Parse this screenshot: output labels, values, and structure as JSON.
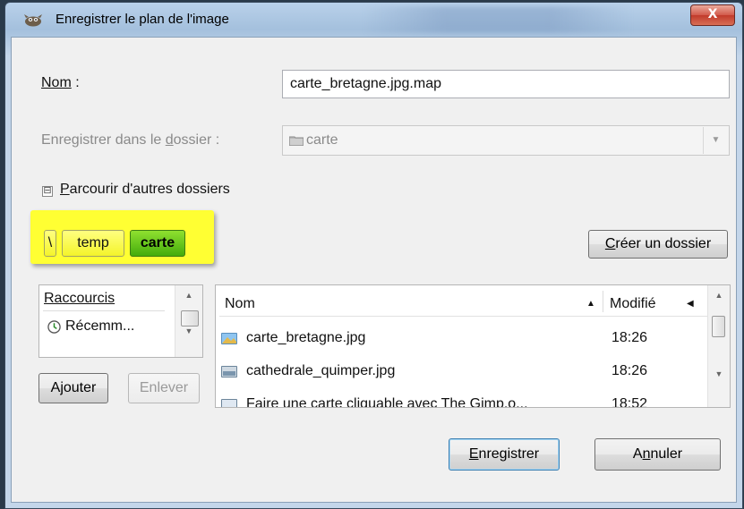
{
  "window": {
    "title": "Enregistrer le plan de l'image",
    "close_label": "X"
  },
  "form": {
    "name_label": "Nom",
    "name_label_suffix": " :",
    "name_value": "carte_bretagne.jpg.map",
    "folder_label_pre": "Enregistrer dans le ",
    "folder_label_u": "d",
    "folder_label_post": "ossier :",
    "folder_value": "carte"
  },
  "browse": {
    "toggle_symbol": "⊟",
    "label_u": "P",
    "label_rest": "arcourir d'autres dossiers"
  },
  "path_bar": {
    "crumbs": [
      "\\",
      "temp",
      "carte"
    ],
    "active_index": 2
  },
  "create_folder": {
    "label_u": "C",
    "label_rest": "réer un dossier"
  },
  "places": {
    "header": "Raccourcis",
    "items": [
      {
        "label": "Récemm...",
        "icon": "recent-icon"
      }
    ],
    "add_label": "Ajouter",
    "remove_label": "Enlever"
  },
  "files": {
    "columns": {
      "name": "Nom",
      "modified": "Modifié"
    },
    "sort_indicator": "▲",
    "rows": [
      {
        "name": "carte_bretagne.jpg",
        "modified": "18:26",
        "icon": "image-file-icon"
      },
      {
        "name": "cathedrale_quimper.jpg",
        "modified": "18:26",
        "icon": "image-file-icon"
      },
      {
        "name": "Faire une carte cliquable avec The Gimp.o...",
        "modified": "18:52",
        "icon": "document-file-icon"
      }
    ]
  },
  "actions": {
    "save_u": "E",
    "save_rest": "nregistrer",
    "cancel_pre": "A",
    "cancel_u": "n",
    "cancel_post": "nuler"
  },
  "colors": {
    "highlight": "#ffff33",
    "active_crumb": "#5cbf14",
    "close_button": "#c94433"
  }
}
